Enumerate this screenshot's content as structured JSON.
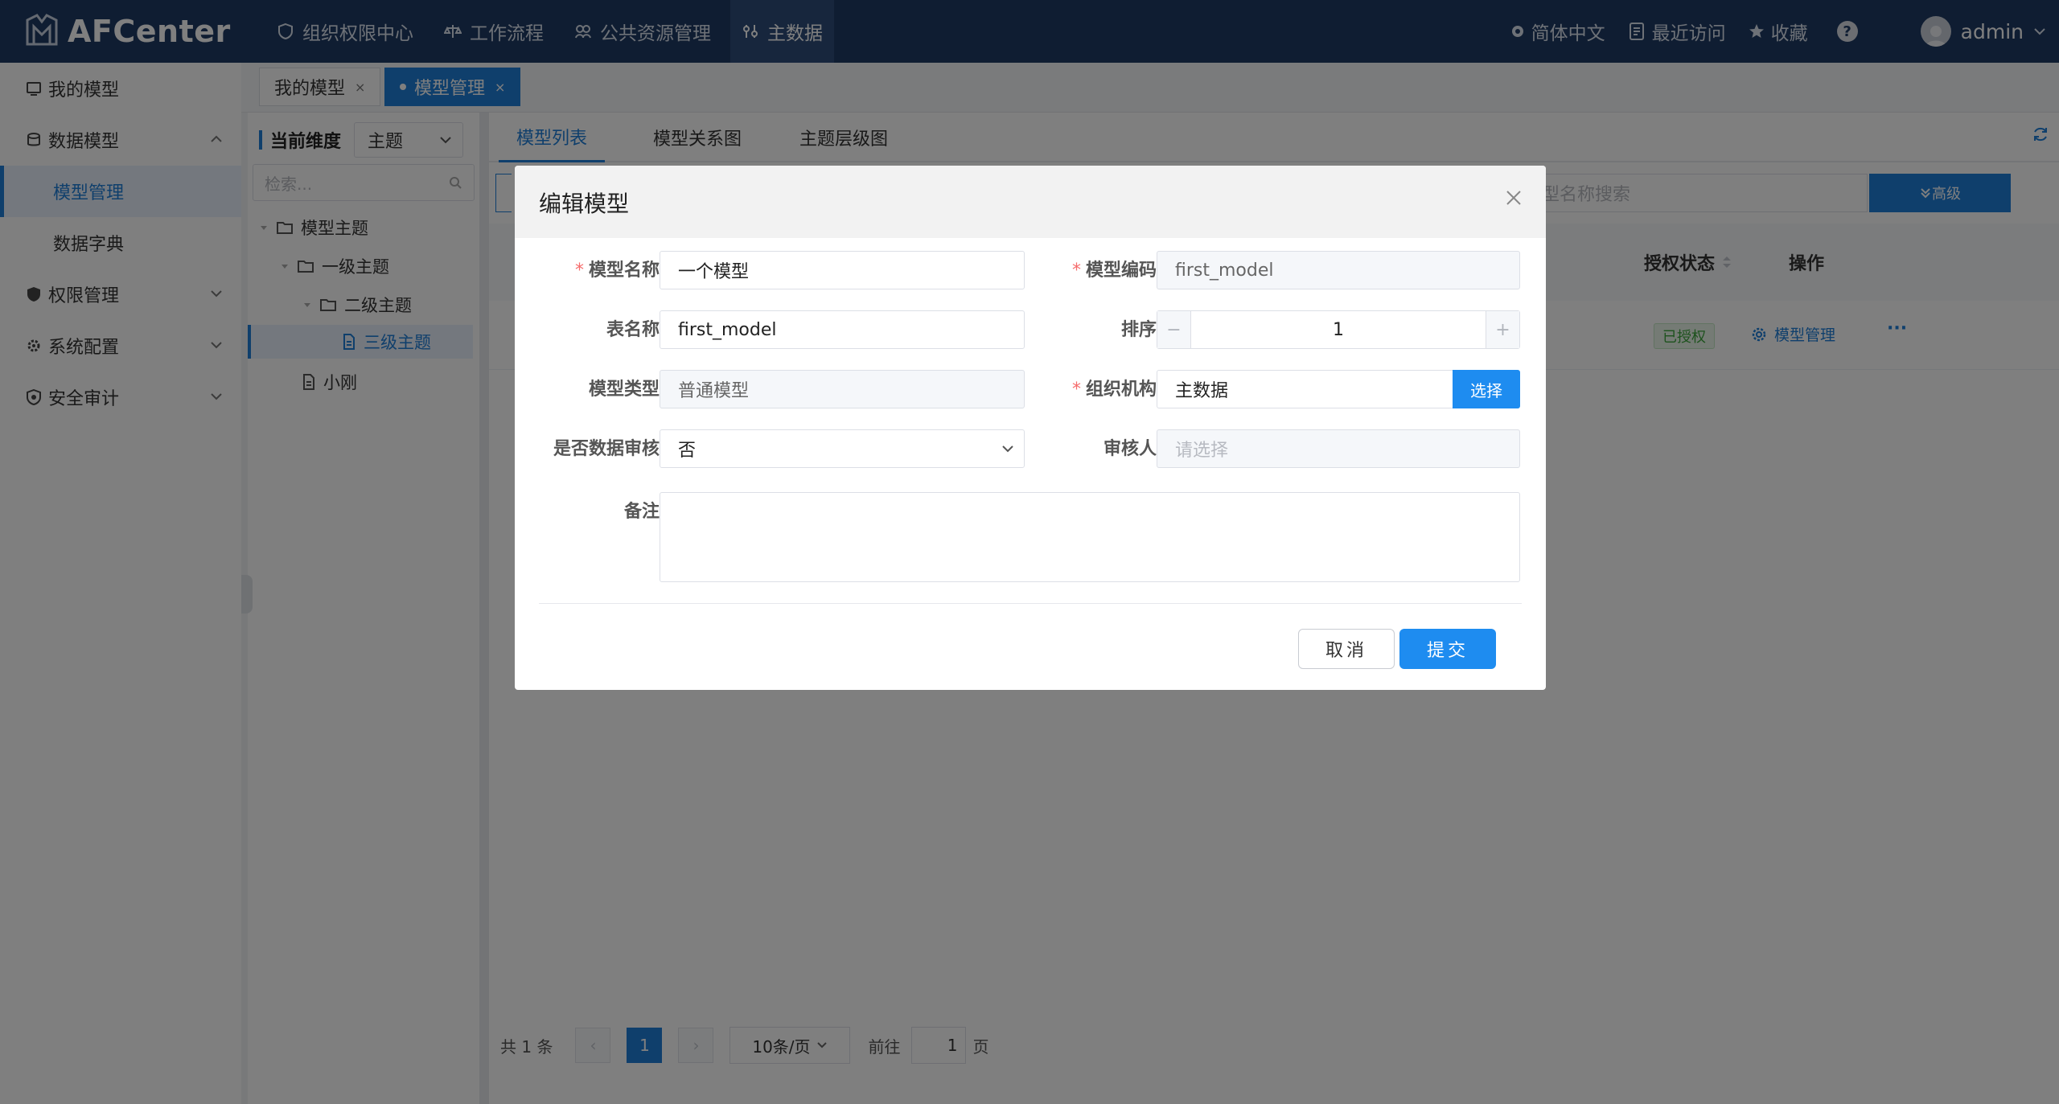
{
  "app": {
    "logo_text": "AFCenter"
  },
  "topnav": [
    {
      "label": "组织权限中心",
      "icon": "shield-icon"
    },
    {
      "label": "工作流程",
      "icon": "scale-icon"
    },
    {
      "label": "公共资源管理",
      "icon": "resource-icon"
    },
    {
      "label": "主数据",
      "icon": "master-data-icon",
      "active": true
    }
  ],
  "topright": {
    "language": "简体中文",
    "recent": "最近访问",
    "favorites": "收藏",
    "help": "?",
    "user": "admin"
  },
  "sidebar": {
    "items": [
      {
        "label": "我的模型"
      },
      {
        "label": "数据模型"
      },
      {
        "label": "模型管理",
        "active": true
      },
      {
        "label": "数据字典"
      },
      {
        "label": "权限管理"
      },
      {
        "label": "系统配置"
      },
      {
        "label": "安全审计"
      }
    ]
  },
  "page_tabs": [
    {
      "label": "我的模型",
      "close": "×"
    },
    {
      "label": "模型管理",
      "close": "×",
      "active": true
    }
  ],
  "tree": {
    "dim_label": "当前维度",
    "dim_value": "主题",
    "search_placeholder": "检索...",
    "nodes": [
      "模型主题",
      "一级主题",
      "二级主题",
      "三级主题",
      "小刚"
    ]
  },
  "main_tabs": [
    "模型列表",
    "模型关系图",
    "主题层级图"
  ],
  "search": {
    "placeholder_fragment": "型名称搜索",
    "advanced": "高级"
  },
  "table": {
    "headers": {
      "auth_status": "授权状态",
      "actions": "操作"
    },
    "row": {
      "auth_badge": "已授权",
      "op_link": "模型管理",
      "op_more": "···"
    }
  },
  "pagination": {
    "total": "共 1 条",
    "current_page": "1",
    "page_size": "10条/页",
    "goto_prefix": "前往",
    "goto_value": "1",
    "goto_suffix": "页"
  },
  "modal": {
    "title": "编辑模型",
    "fields": {
      "model_name": {
        "label": "模型名称",
        "value": "一个模型",
        "required": true
      },
      "model_code": {
        "label": "模型编码",
        "value": "first_model",
        "required": true
      },
      "table_name": {
        "label": "表名称",
        "value": "first_model"
      },
      "sort": {
        "label": "排序",
        "value": "1",
        "minus": "−",
        "plus": "+"
      },
      "model_type": {
        "label": "模型类型",
        "value": "普通模型"
      },
      "org": {
        "label": "组织机构",
        "value": "主数据",
        "required": true,
        "select_btn": "选择"
      },
      "data_review": {
        "label": "是否数据审核",
        "value": "否"
      },
      "reviewer": {
        "label": "审核人",
        "placeholder": "请选择"
      },
      "remark": {
        "label": "备注",
        "value": ""
      }
    },
    "buttons": {
      "cancel": "取消",
      "submit": "提交"
    }
  },
  "colors": {
    "header_bg": "#1f3a64",
    "primary": "#1f7ed8",
    "submit": "#1e8cf0",
    "required": "#f56c6c",
    "success": "#3aa53a"
  }
}
